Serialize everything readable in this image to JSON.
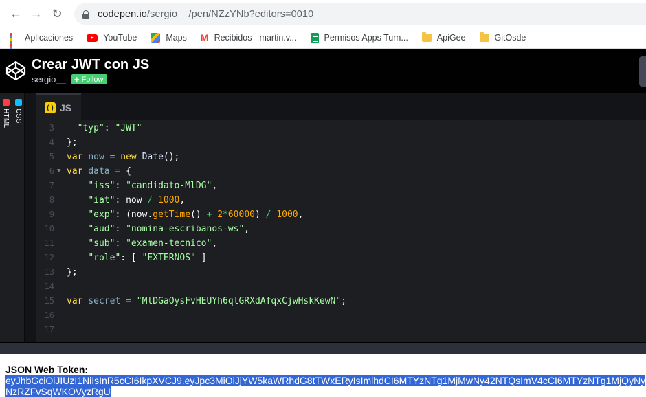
{
  "browser": {
    "url_host": "codepen.io",
    "url_path": "/sergio__/pen/NZzYNb?editors=0010",
    "bookmarks": [
      {
        "label": "Aplicaciones",
        "icon": "apps-icon"
      },
      {
        "label": "YouTube",
        "icon": "youtube-icon"
      },
      {
        "label": "Maps",
        "icon": "maps-icon"
      },
      {
        "label": "Recibidos - martin.v...",
        "icon": "gmail-icon"
      },
      {
        "label": "Permisos Apps Turn...",
        "icon": "sheets-icon"
      },
      {
        "label": "ApiGee",
        "icon": "folder-icon"
      },
      {
        "label": "GitOsde",
        "icon": "folder-icon"
      }
    ]
  },
  "pen": {
    "title": "Crear JWT con JS",
    "author": "sergio__",
    "follow_label": "Follow"
  },
  "panels": {
    "html_label": "HTML",
    "css_label": "CSS",
    "js_label": "JS",
    "html_color": "#ff3c41",
    "css_color": "#0ebeff",
    "js_color": "#fcd000"
  },
  "editor": {
    "line_numbers": [
      "3",
      "4",
      "5",
      "6",
      "7",
      "8",
      "9",
      "10",
      "11",
      "12",
      "13",
      "14",
      "15",
      "16",
      "17"
    ]
  },
  "result": {
    "label": "JSON Web Token:",
    "token_line1": "eyJhbGciOiJIUzI1NiIsInR5cCI6IkpXVCJ9.eyJpc3MiOiJjYW5kaWRhdG8tTWxERyIsImlhdCI6MTYzNTg1MjMwNy42NTQsImV4cCI6MTYzNTg1MjQyNy",
    "token_line2": "NzRZFvSqWKOVyzRgU"
  }
}
